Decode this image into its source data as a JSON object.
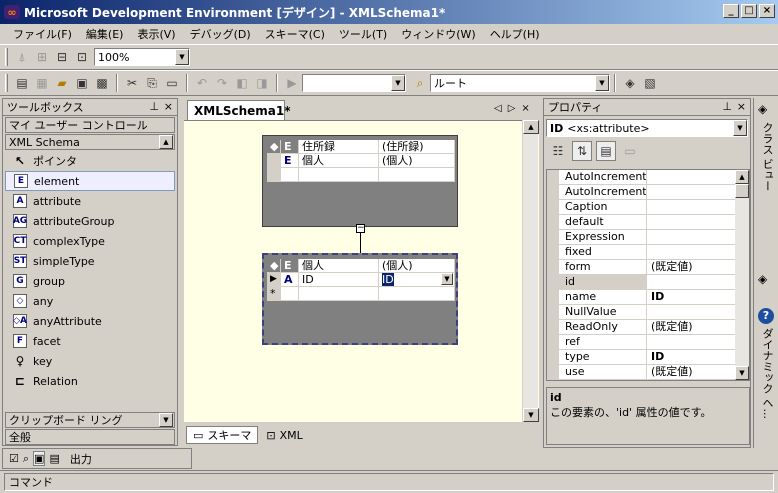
{
  "window": {
    "title": "Microsoft Development Environment [デザイン] - XMLSchema1*"
  },
  "menu": [
    "ファイル(F)",
    "編集(E)",
    "表示(V)",
    "デバッグ(D)",
    "スキーマ(C)",
    "ツール(T)",
    "ウィンドウ(W)",
    "ヘルプ(H)"
  ],
  "toolbar1": {
    "zoom": "100%"
  },
  "toolbar2": {
    "root_label": "ルート"
  },
  "toolbox": {
    "title": "ツールボックス",
    "category_user": "マイ ユーザー コントロール",
    "category_xml": "XML Schema",
    "items": [
      {
        "label": "ポインタ",
        "icon": "pointer-icon",
        "glyph": "↖"
      },
      {
        "label": "element",
        "icon": "element-icon",
        "glyph": "E"
      },
      {
        "label": "attribute",
        "icon": "attribute-icon",
        "glyph": "A"
      },
      {
        "label": "attributeGroup",
        "icon": "attribute-group-icon",
        "glyph": "AG"
      },
      {
        "label": "complexType",
        "icon": "complex-type-icon",
        "glyph": "CT"
      },
      {
        "label": "simpleType",
        "icon": "simple-type-icon",
        "glyph": "ST"
      },
      {
        "label": "group",
        "icon": "group-icon",
        "glyph": "G"
      },
      {
        "label": "any",
        "icon": "any-icon",
        "glyph": "◇"
      },
      {
        "label": "anyAttribute",
        "icon": "any-attribute-icon",
        "glyph": "◇A"
      },
      {
        "label": "facet",
        "icon": "facet-icon",
        "glyph": "F"
      },
      {
        "label": "key",
        "icon": "key-icon",
        "glyph": "♀"
      },
      {
        "label": "Relation",
        "icon": "relation-icon",
        "glyph": "⊏"
      }
    ],
    "category_clipboard": "クリップボード リング",
    "category_general": "全般"
  },
  "document": {
    "tab_label": "XMLSchema1*",
    "grid1": {
      "header_type": "E",
      "header_name": "住所録",
      "header_value": "(住所録)",
      "rows": [
        {
          "type": "E",
          "name": "個人",
          "value": "(個人)"
        }
      ]
    },
    "grid2": {
      "header_type": "E",
      "header_name": "個人",
      "header_value": "(個人)",
      "rows": [
        {
          "type": "A",
          "name": "ID",
          "value": "ID"
        }
      ],
      "new_row_marker": "*"
    },
    "bottom_tabs": [
      "スキーマ",
      "XML"
    ]
  },
  "properties": {
    "title": "プロパティ",
    "object": "ID",
    "object_type": "<xs:attribute>",
    "rows": [
      {
        "name": "AutoIncrementSe",
        "value": ""
      },
      {
        "name": "AutoIncrementSt",
        "value": ""
      },
      {
        "name": "Caption",
        "value": ""
      },
      {
        "name": "default",
        "value": ""
      },
      {
        "name": "Expression",
        "value": ""
      },
      {
        "name": "fixed",
        "value": ""
      },
      {
        "name": "form",
        "value": "(既定値)"
      },
      {
        "name": "id",
        "value": ""
      },
      {
        "name": "name",
        "value": "ID"
      },
      {
        "name": "NullValue",
        "value": ""
      },
      {
        "name": "ReadOnly",
        "value": "(既定値)"
      },
      {
        "name": "ref",
        "value": ""
      },
      {
        "name": "type",
        "value": "ID"
      },
      {
        "name": "use",
        "value": "(既定値)"
      }
    ],
    "desc_title": "id",
    "desc_text": "この要素の、'id' 属性の値です。"
  },
  "right_strip": {
    "class_view": "クラス ビュー",
    "dynamic_help": "ダイナミック ヘ..."
  },
  "output": {
    "label": "出力"
  },
  "status": {
    "text": "コマンド"
  }
}
